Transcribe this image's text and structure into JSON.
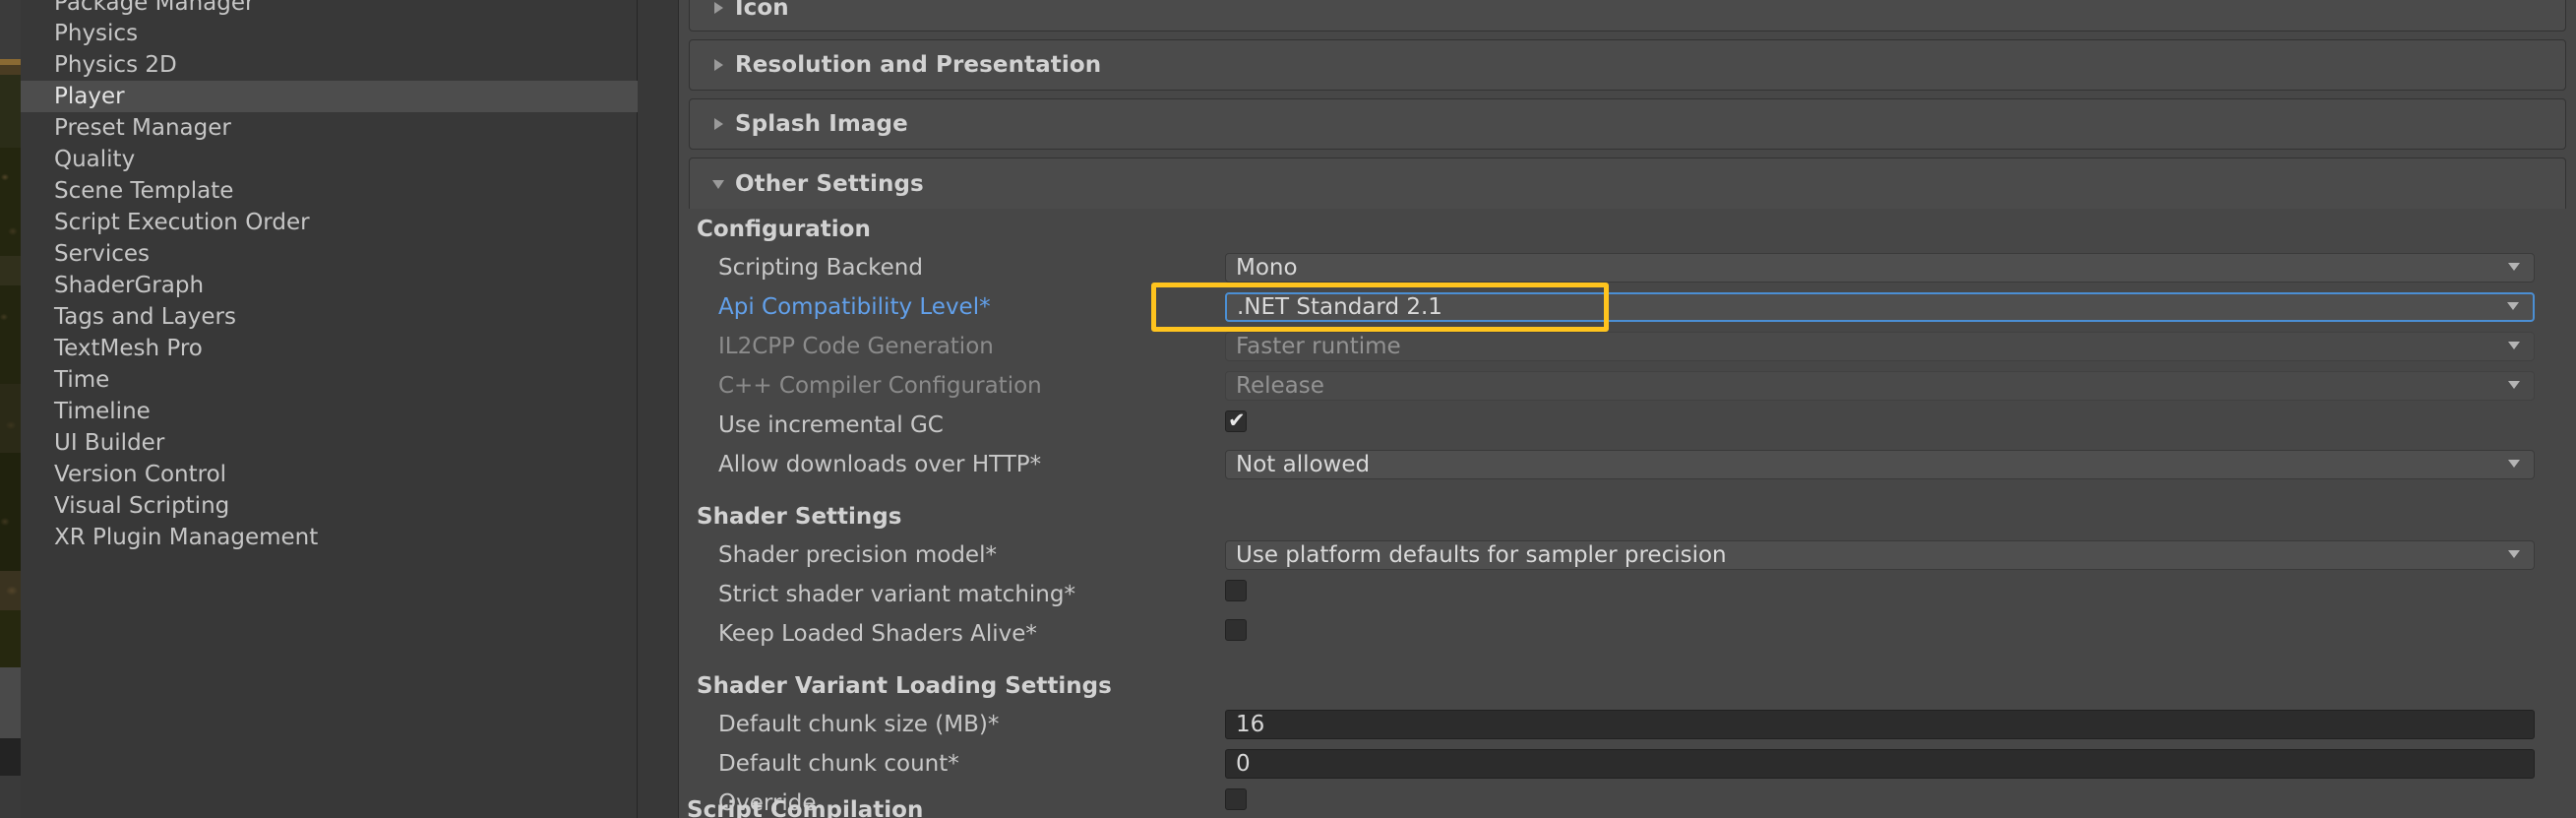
{
  "sidebar": {
    "items": [
      {
        "label": "Package Manager",
        "selected": false,
        "clipped": true
      },
      {
        "label": "Physics",
        "selected": false
      },
      {
        "label": "Physics 2D",
        "selected": false
      },
      {
        "label": "Player",
        "selected": true
      },
      {
        "label": "Preset Manager",
        "selected": false
      },
      {
        "label": "Quality",
        "selected": false
      },
      {
        "label": "Scene Template",
        "selected": false
      },
      {
        "label": "Script Execution Order",
        "selected": false
      },
      {
        "label": "Services",
        "selected": false
      },
      {
        "label": "ShaderGraph",
        "selected": false
      },
      {
        "label": "Tags and Layers",
        "selected": false
      },
      {
        "label": "TextMesh Pro",
        "selected": false
      },
      {
        "label": "Time",
        "selected": false
      },
      {
        "label": "Timeline",
        "selected": false
      },
      {
        "label": "UI Builder",
        "selected": false
      },
      {
        "label": "Version Control",
        "selected": false
      },
      {
        "label": "Visual Scripting",
        "selected": false
      },
      {
        "label": "XR Plugin Management",
        "selected": false
      }
    ]
  },
  "colors": {
    "accent_link": "#62a0ea",
    "focus_border": "#4b8fd4",
    "highlight_box": "#ffc41e",
    "panel_bg": "#474747",
    "sidebar_selected": "#4d4d4d"
  },
  "sections": {
    "icon": {
      "title": "Icon",
      "expanded": false
    },
    "resolution": {
      "title": "Resolution and Presentation",
      "expanded": false
    },
    "splash": {
      "title": "Splash Image",
      "expanded": false
    },
    "other": {
      "title": "Other Settings",
      "expanded": true
    }
  },
  "configuration": {
    "heading": "Configuration",
    "rows": [
      {
        "label": "Scripting Backend",
        "value": "Mono",
        "kind": "popup",
        "state": "normal"
      },
      {
        "label": "Api Compatibility Level*",
        "value": ".NET Standard 2.1",
        "kind": "popup",
        "state": "focused",
        "label_style": "accent",
        "highlighted": true
      },
      {
        "label": "IL2CPP Code Generation",
        "value": "Faster runtime",
        "kind": "popup",
        "state": "disabled",
        "label_style": "disabled"
      },
      {
        "label": "C++ Compiler Configuration",
        "value": "Release",
        "kind": "popup",
        "state": "disabled",
        "label_style": "disabled"
      },
      {
        "label": "Use incremental GC",
        "value": "",
        "kind": "checkbox",
        "checked": true
      },
      {
        "label": "Allow downloads over HTTP*",
        "value": "Not allowed",
        "kind": "popup",
        "state": "normal"
      }
    ]
  },
  "shader_settings": {
    "heading": "Shader Settings",
    "rows": [
      {
        "label": "Shader precision model*",
        "value": "Use platform defaults for sampler precision",
        "kind": "popup",
        "state": "normal"
      },
      {
        "label": "Strict shader variant matching*",
        "value": "",
        "kind": "checkbox",
        "checked": false
      },
      {
        "label": "Keep Loaded Shaders Alive*",
        "value": "",
        "kind": "checkbox",
        "checked": false
      }
    ]
  },
  "shader_variant_loading": {
    "heading": "Shader Variant Loading Settings",
    "rows": [
      {
        "label": "Default chunk size (MB)*",
        "value": "16",
        "kind": "number"
      },
      {
        "label": "Default chunk count*",
        "value": "0",
        "kind": "number"
      },
      {
        "label": "Override",
        "value": "",
        "kind": "checkbox",
        "checked": false
      }
    ]
  },
  "script_compilation": {
    "heading": "Script Compilation"
  },
  "icons": {
    "foldout_collapsed": "triangle-right-icon",
    "foldout_expanded": "triangle-down-icon",
    "popup_caret": "chevron-down-icon",
    "checkmark": "check-icon"
  }
}
